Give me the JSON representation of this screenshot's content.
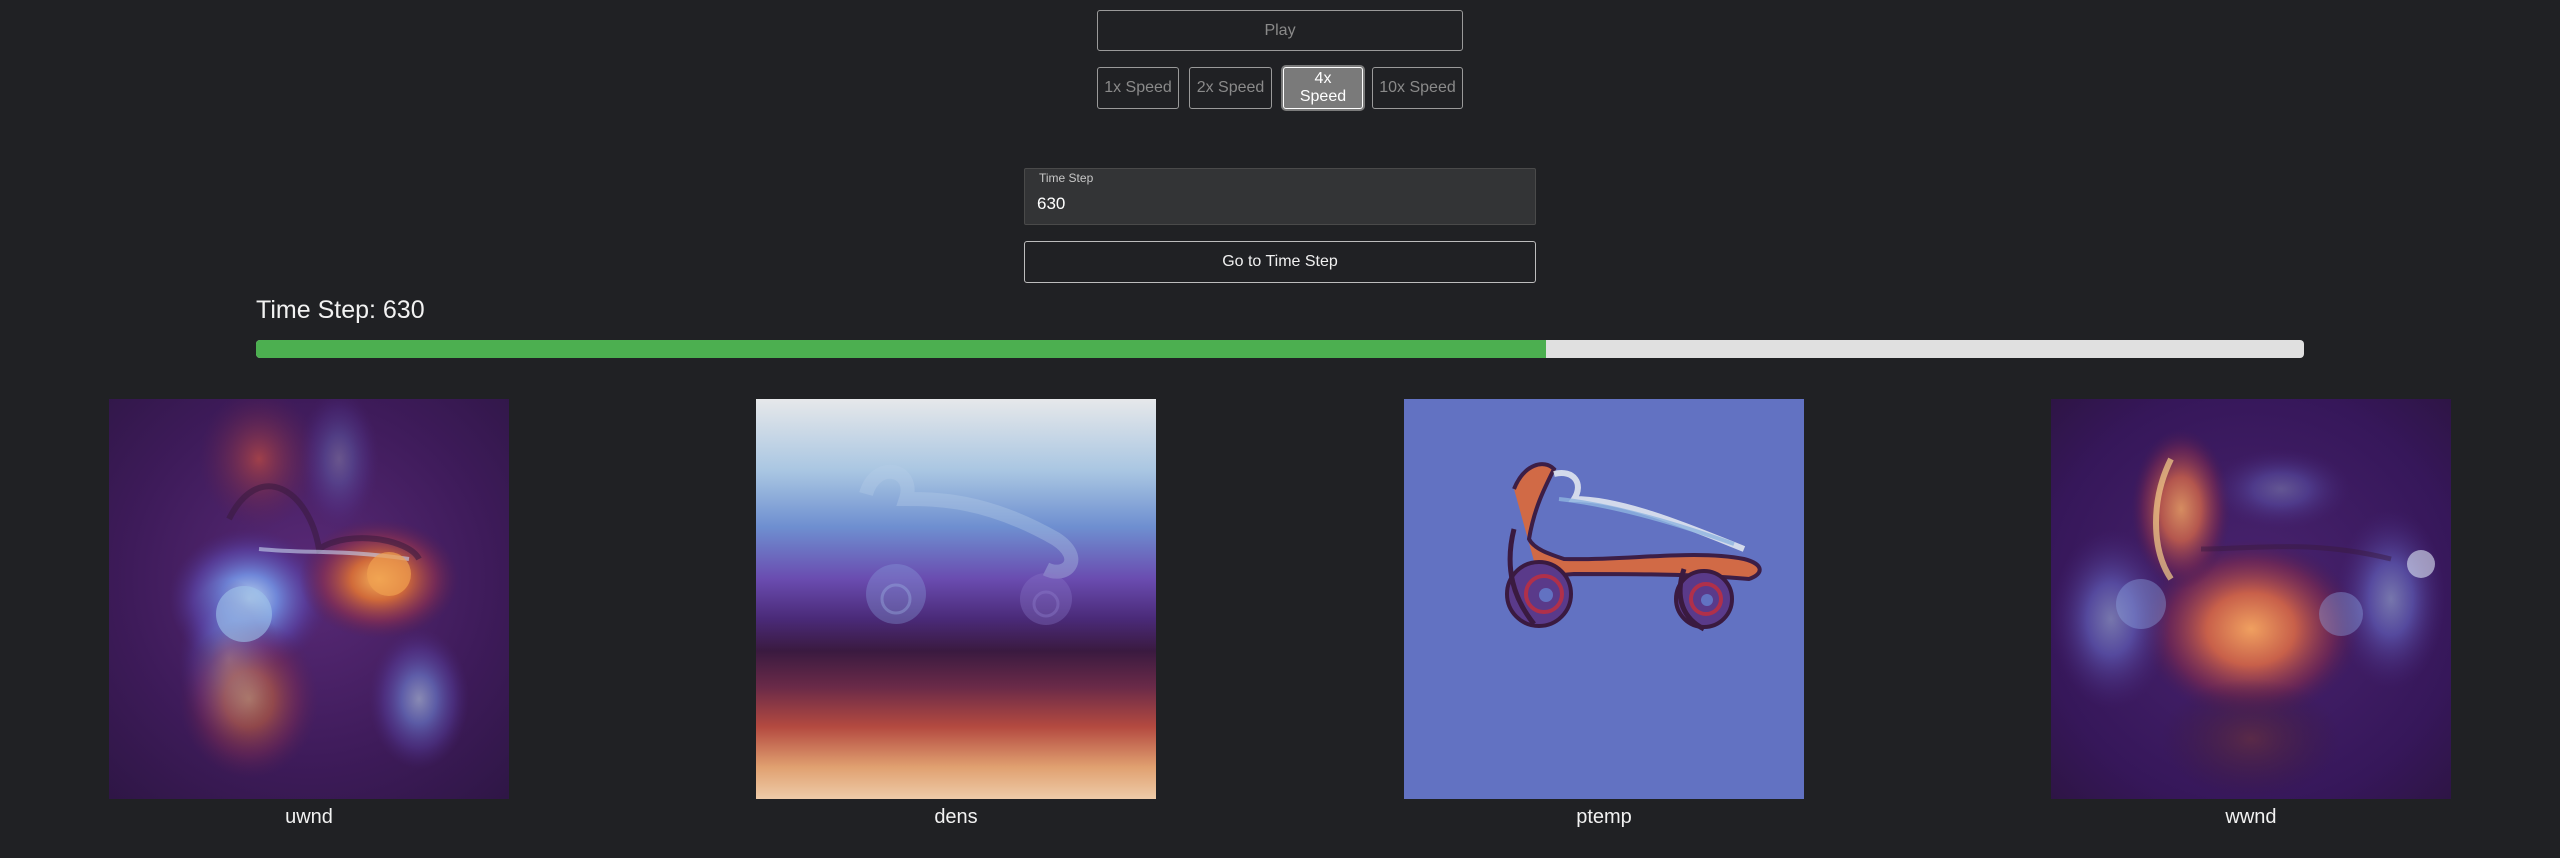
{
  "controls": {
    "play_label": "Play",
    "speeds": [
      "1x Speed",
      "2x Speed",
      "4x Speed",
      "10x Speed"
    ],
    "active_speed": "4x Speed"
  },
  "timestep": {
    "field_label": "Time Step",
    "value": "630",
    "goto_label": "Go to Time Step",
    "title": "Time Step: 630",
    "progress": 0.63
  },
  "panels": [
    {
      "label": "uwnd",
      "colormap": "twilight"
    },
    {
      "label": "dens",
      "colormap": "twilight"
    },
    {
      "label": "ptemp",
      "colormap": "twilight"
    },
    {
      "label": "wwnd",
      "colormap": "twilight"
    }
  ],
  "colors": {
    "background": "#202124",
    "progress_fill": "#4caf50",
    "progress_track": "#e0e0e0",
    "active_button": "#7a7a7a"
  }
}
